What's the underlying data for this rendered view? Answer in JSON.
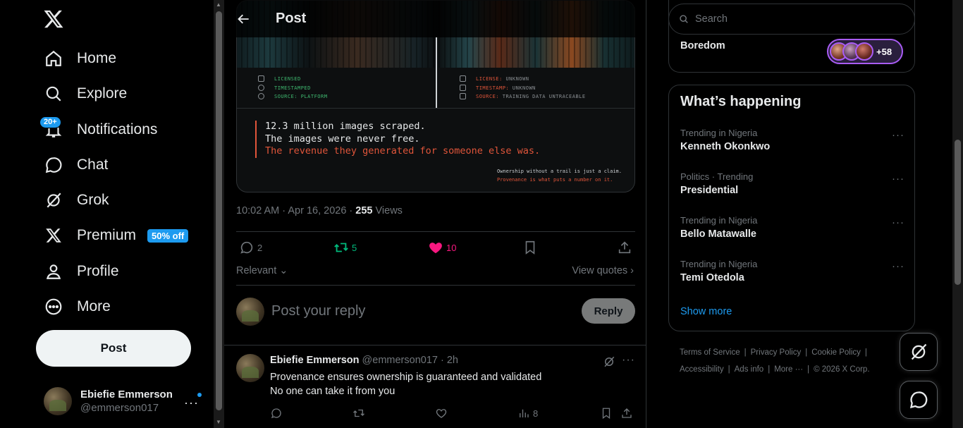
{
  "nav": {
    "items": [
      {
        "label": "Home",
        "icon": "home-icon"
      },
      {
        "label": "Explore",
        "icon": "search-icon"
      },
      {
        "label": "Notifications",
        "icon": "bell-icon",
        "badge": "20+"
      },
      {
        "label": "Chat",
        "icon": "chat-icon"
      },
      {
        "label": "Grok",
        "icon": "grok-icon"
      },
      {
        "label": "Premium",
        "icon": "x-icon",
        "promo": "50% off"
      },
      {
        "label": "Profile",
        "icon": "person-icon"
      },
      {
        "label": "More",
        "icon": "more-circle-icon"
      }
    ],
    "post_label": "Post"
  },
  "account": {
    "name": "Ebiefie Emmerson",
    "handle": "@emmerson017"
  },
  "header": {
    "title": "Post"
  },
  "media": {
    "left_meta": [
      "LICENSED",
      "TIMESTAMPED",
      "SOURCE: PLATFORM"
    ],
    "right_meta": [
      {
        "key": "LICENSE:",
        "val": "UNKNOWN"
      },
      {
        "key": "TIMESTAMP:",
        "val": "UNKNOWN"
      },
      {
        "key": "SOURCE:",
        "val": "TRAINING DATA UNTRACEABLE"
      }
    ],
    "quote_lines": [
      "12.3 million images scraped.",
      "The images were never free.",
      "The revenue they generated for someone else was."
    ],
    "footnote": [
      "Ownership without a trail is just a claim.",
      "Provenance is what puts a number on it."
    ]
  },
  "post": {
    "time": "10:02 AM · Apr 16, 2026 · ",
    "views_count": "255",
    "views_label": " Views",
    "replies": "2",
    "reposts": "5",
    "likes": "10"
  },
  "sort": {
    "label": "Relevant",
    "view_quotes": "View quotes"
  },
  "composer": {
    "placeholder": "Post your reply",
    "button": "Reply"
  },
  "reply": {
    "name": "Ebiefie Emmerson",
    "handle": "@emmerson017 · 2h",
    "lines": [
      "Provenance ensures ownership is guaranteed and validated",
      "No one can take it from you"
    ],
    "views": "8"
  },
  "search": {
    "placeholder": "Search"
  },
  "space": {
    "title": "Boredom",
    "listeners": "+58"
  },
  "trends": {
    "title": "What’s happening",
    "items": [
      {
        "context": "Trending in Nigeria",
        "name": "Kenneth Okonkwo"
      },
      {
        "context": "Politics · Trending",
        "name": "Presidential"
      },
      {
        "context": "Trending in Nigeria",
        "name": "Bello Matawalle"
      },
      {
        "context": "Trending in Nigeria",
        "name": "Temi Otedola"
      }
    ],
    "show_more": "Show more"
  },
  "footer": {
    "links": [
      "Terms of Service",
      "Privacy Policy",
      "Cookie Policy",
      "Accessibility",
      "Ads info",
      "More ···"
    ],
    "copyright": "© 2026 X Corp."
  },
  "colors": {
    "accent": "#1d9bf0",
    "like": "#f91880",
    "repost": "#00ba7c",
    "text": "#e7e9ea",
    "muted": "#71767b",
    "border": "#2f3336"
  }
}
